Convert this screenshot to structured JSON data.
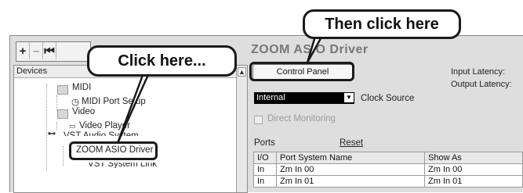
{
  "toolbar": {
    "add": "+",
    "remove": "–",
    "skip": "⏮"
  },
  "devices_panel": {
    "header": "Devices",
    "tree": [
      {
        "label": "MIDI"
      },
      {
        "label": "MIDI Port Setup"
      },
      {
        "label": "Video"
      },
      {
        "label": "Video Player"
      },
      {
        "label": "VST Audio System"
      },
      {
        "label": "ZOOM ASIO Driver"
      },
      {
        "label": "VST System Link"
      }
    ]
  },
  "driver": {
    "title": "ZOOM ASIO Driver",
    "control_panel_label": "Control Panel",
    "input_latency_label": "Input Latency:",
    "output_latency_label": "Output Latency:",
    "clock_source_value": "Internal",
    "clock_source_label": "Clock Source",
    "direct_monitoring_label": "Direct Monitoring",
    "ports_label": "Ports",
    "reset_label": "Reset"
  },
  "ports_table": {
    "columns": [
      "I/O",
      "Port System Name",
      "Show As"
    ],
    "rows": [
      [
        "In",
        "Zm In 00",
        "Zm In 00"
      ],
      [
        "In",
        "Zm In 01",
        "Zm In 01"
      ]
    ]
  },
  "callouts": {
    "click_here": "Click here...",
    "then_click_here": "Then click here"
  }
}
